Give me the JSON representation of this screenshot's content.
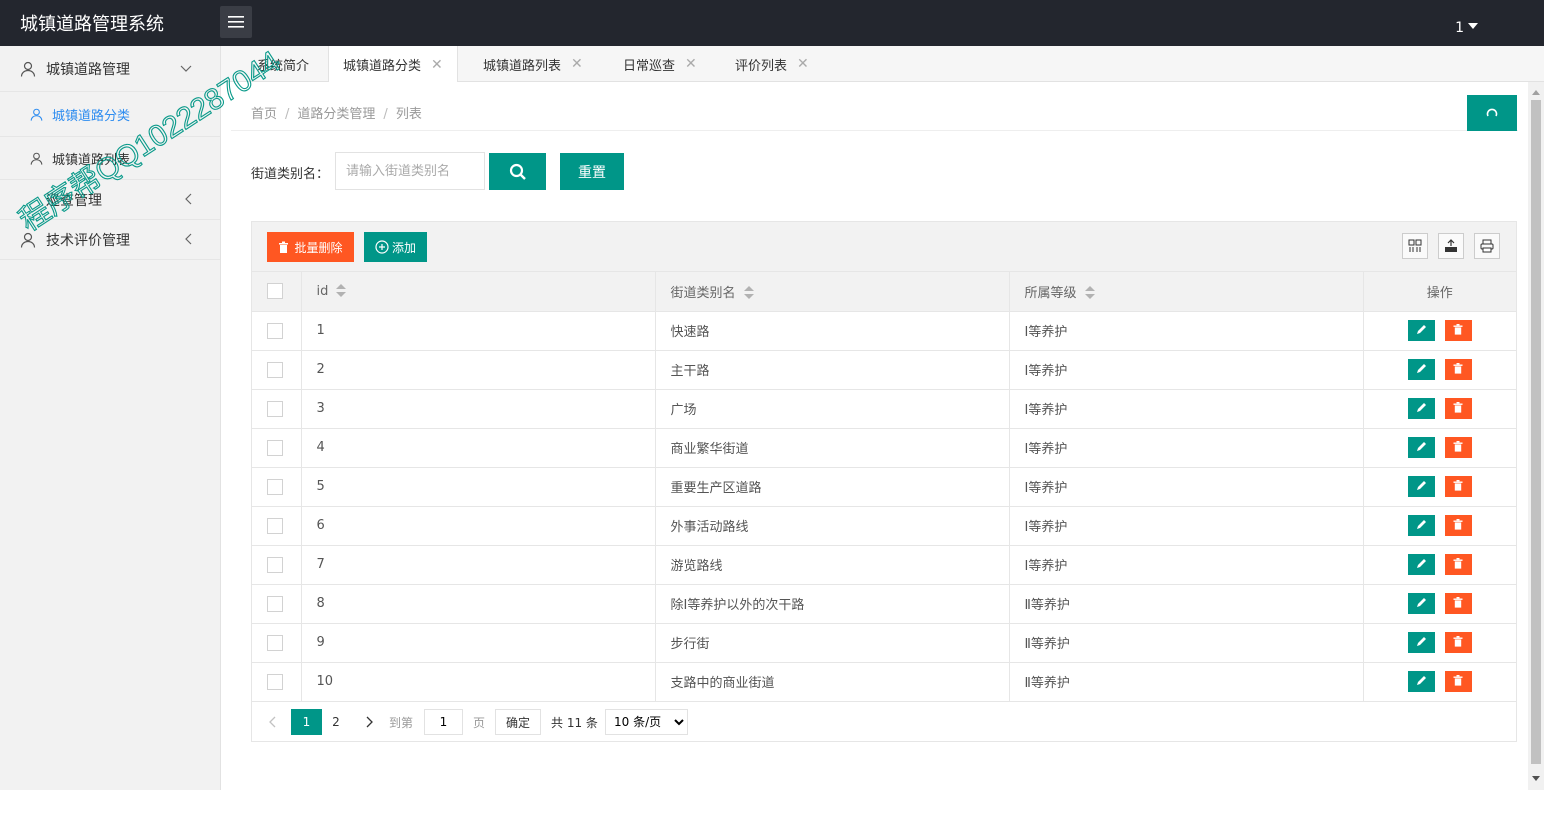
{
  "app": {
    "title": "城镇道路管理系统",
    "user": "1"
  },
  "sidebar": {
    "groups": [
      {
        "label": "城镇道路管理",
        "items": [
          {
            "label": "城镇道路分类"
          },
          {
            "label": "城镇道路列表"
          }
        ]
      },
      {
        "label": "巡查管理"
      },
      {
        "label": "技术评价管理"
      }
    ]
  },
  "tabs": [
    {
      "label": "系统简介"
    },
    {
      "label": "城镇道路分类"
    },
    {
      "label": "城镇道路列表"
    },
    {
      "label": "日常巡查"
    },
    {
      "label": "评价列表"
    }
  ],
  "breadcrumb": [
    "首页",
    "道路分类管理",
    "列表"
  ],
  "search": {
    "label": "街道类别名：",
    "placeholder": "请输入街道类别名",
    "reset_label": "重置"
  },
  "toolbar": {
    "batch_delete": "批量删除",
    "add": "添加"
  },
  "table": {
    "columns": [
      "id",
      "街道类别名",
      "所属等级",
      "操作"
    ],
    "rows": [
      {
        "id": "1",
        "name": "快速路",
        "level": "Ⅰ等养护"
      },
      {
        "id": "2",
        "name": "主干路",
        "level": "Ⅰ等养护"
      },
      {
        "id": "3",
        "name": "广场",
        "level": "Ⅰ等养护"
      },
      {
        "id": "4",
        "name": "商业繁华街道",
        "level": "Ⅰ等养护"
      },
      {
        "id": "5",
        "name": "重要生产区道路",
        "level": "Ⅰ等养护"
      },
      {
        "id": "6",
        "name": "外事活动路线",
        "level": "Ⅰ等养护"
      },
      {
        "id": "7",
        "name": "游览路线",
        "level": "Ⅰ等养护"
      },
      {
        "id": "8",
        "name": "除Ⅰ等养护以外的次干路",
        "level": "Ⅱ等养护"
      },
      {
        "id": "9",
        "name": "步行街",
        "level": "Ⅱ等养护"
      },
      {
        "id": "10",
        "name": "支路中的商业街道",
        "level": "Ⅱ等养护"
      }
    ]
  },
  "pager": {
    "current": "1",
    "next_page": "2",
    "goto_label": "到第",
    "goto_value": "1",
    "page_unit": "页",
    "confirm": "确定",
    "total": "共 11 条",
    "page_size": "10 条/页"
  },
  "watermark": "程序帮QQ1022287044",
  "colors": {
    "primary": "#009688",
    "danger": "#ff5722",
    "header": "#23262e",
    "active_link": "#2d8cf0"
  },
  "icons": [
    "menu-icon",
    "user-icon",
    "chevron-down-icon",
    "chevron-left-icon",
    "close-icon",
    "refresh-icon",
    "search-icon",
    "trash-icon",
    "plus-circle-icon",
    "columns-icon",
    "export-icon",
    "print-icon",
    "edit-icon",
    "prev-icon",
    "next-icon"
  ]
}
